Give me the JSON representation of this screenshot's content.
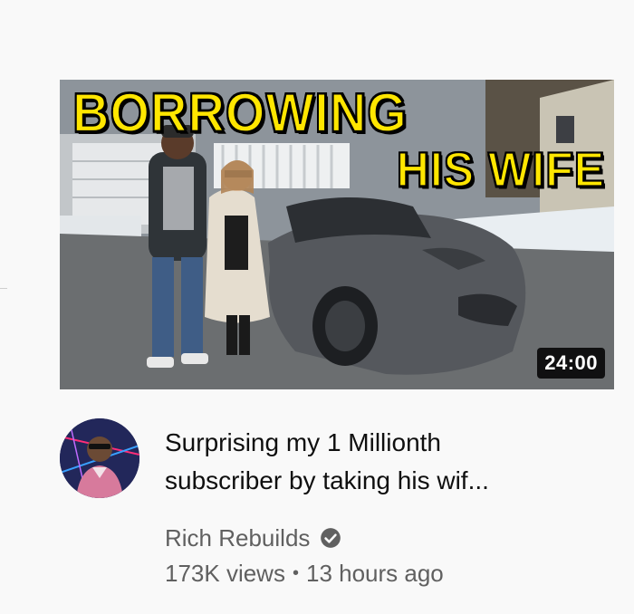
{
  "thumbnail": {
    "headline_line1": "BORROWING",
    "headline_line2": "HIS WIFE",
    "duration": "24:00"
  },
  "video": {
    "title_line1": "Surprising my 1 Millionth",
    "title_line2": "subscriber by taking his wif..."
  },
  "channel": {
    "name": "Rich Rebuilds",
    "verified_icon": "verified-check-icon"
  },
  "meta": {
    "views": "173K views",
    "separator": "•",
    "age": "13 hours ago"
  },
  "colors": {
    "headline_fill": "#ffe600",
    "text_primary": "#0f0f0f",
    "text_secondary": "#606060",
    "background": "#f9f9f9"
  }
}
